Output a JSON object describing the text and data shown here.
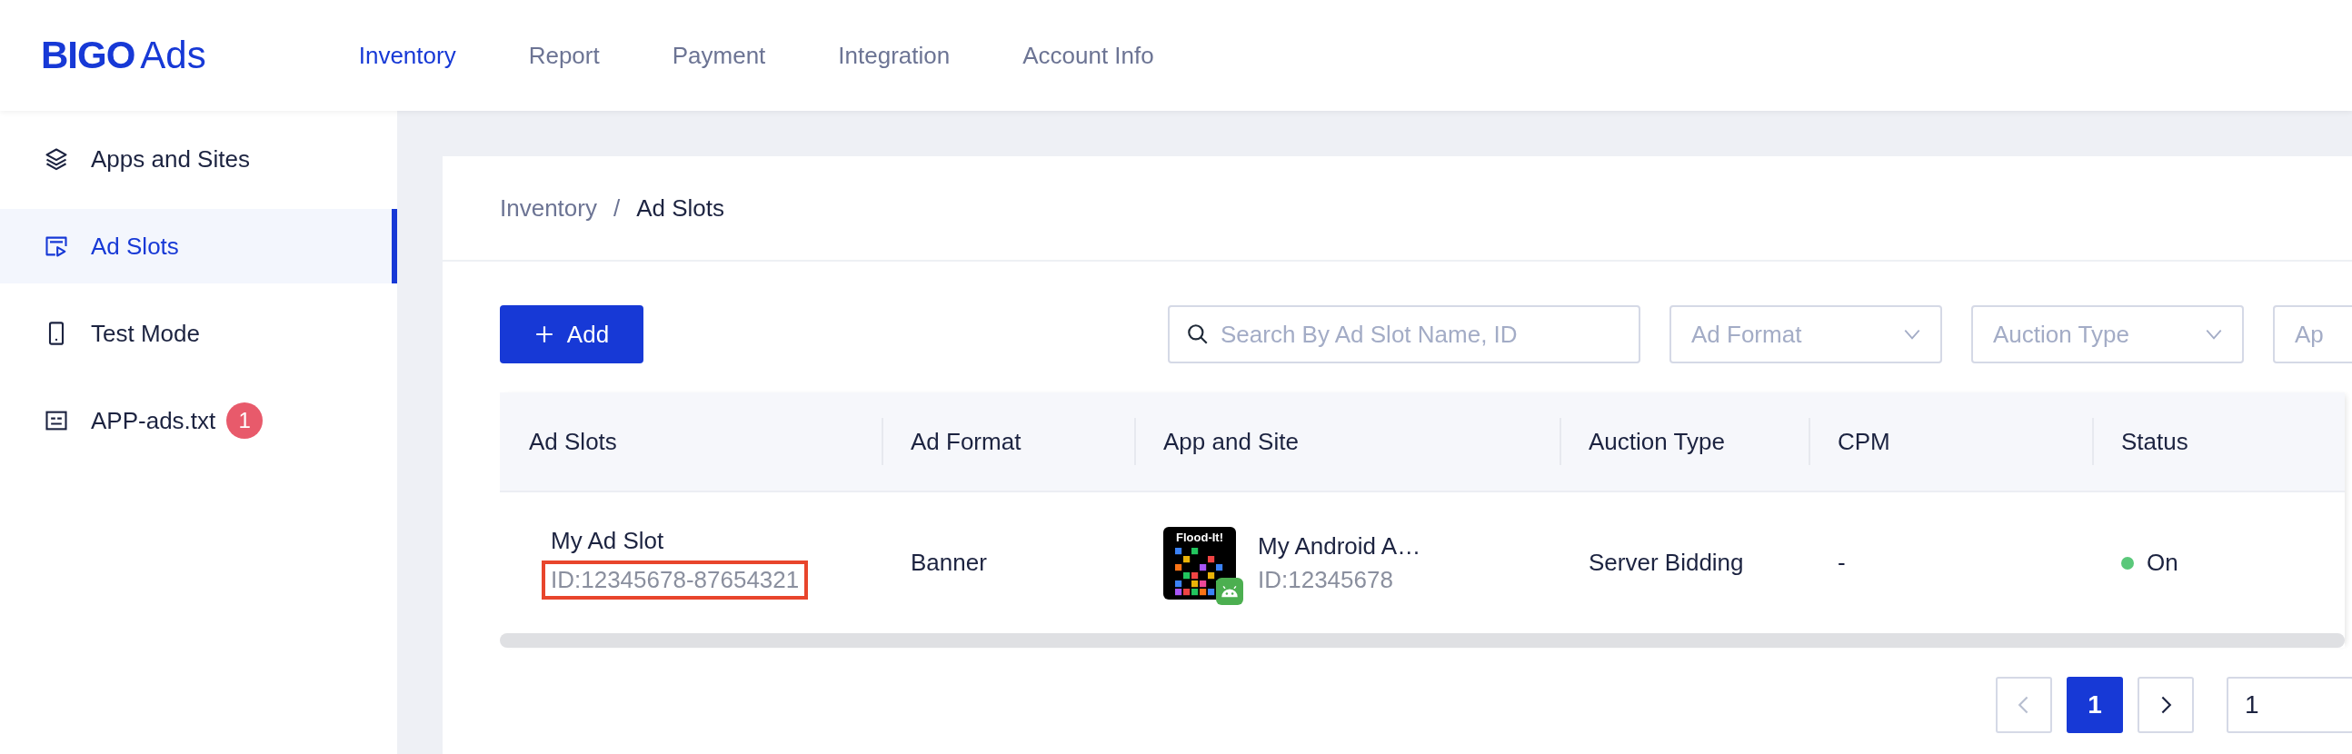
{
  "logo": {
    "brand": "BIGO",
    "product": "Ads"
  },
  "nav": [
    {
      "label": "Inventory",
      "selected": true
    },
    {
      "label": "Report",
      "selected": false
    },
    {
      "label": "Payment",
      "selected": false
    },
    {
      "label": "Integration",
      "selected": false
    },
    {
      "label": "Account Info",
      "selected": false
    }
  ],
  "sidebar": {
    "items": [
      {
        "label": "Apps and Sites",
        "selected": false
      },
      {
        "label": "Ad Slots",
        "selected": true
      },
      {
        "label": "Test Mode",
        "selected": false
      },
      {
        "label": "APP-ads.txt",
        "selected": false,
        "badge": "1"
      }
    ]
  },
  "breadcrumb": {
    "separator": "/",
    "items": [
      {
        "label": "Inventory",
        "current": false
      },
      {
        "label": "Ad Slots",
        "current": true
      }
    ]
  },
  "add_button": {
    "label": "Add"
  },
  "filters": {
    "search": {
      "placeholder": "Search By Ad Slot Name, ID"
    },
    "selects": [
      {
        "placeholder": "Ad Format"
      },
      {
        "placeholder": "Auction Type"
      },
      {
        "placeholder": "Ap"
      }
    ]
  },
  "table": {
    "columns": [
      "Ad Slots",
      "Ad Format",
      "App and Site",
      "Auction Type",
      "CPM",
      "Status"
    ],
    "rows": [
      {
        "ad_slot": {
          "name": "My Ad Slot",
          "id": "ID:12345678-87654321",
          "highlighted": true
        },
        "ad_format": "Banner",
        "app": {
          "icon_label": "Flood-It!",
          "name": "My Android A…",
          "id": "ID:12345678"
        },
        "auction_type": "Server Bidding",
        "cpm": "-",
        "status": {
          "label": "On",
          "on": true
        }
      }
    ]
  },
  "pagination": {
    "prev": {
      "disabled": true
    },
    "pages": [
      {
        "label": "1",
        "selected": true
      }
    ],
    "next": {
      "disabled": false
    },
    "page_size": "1"
  }
}
